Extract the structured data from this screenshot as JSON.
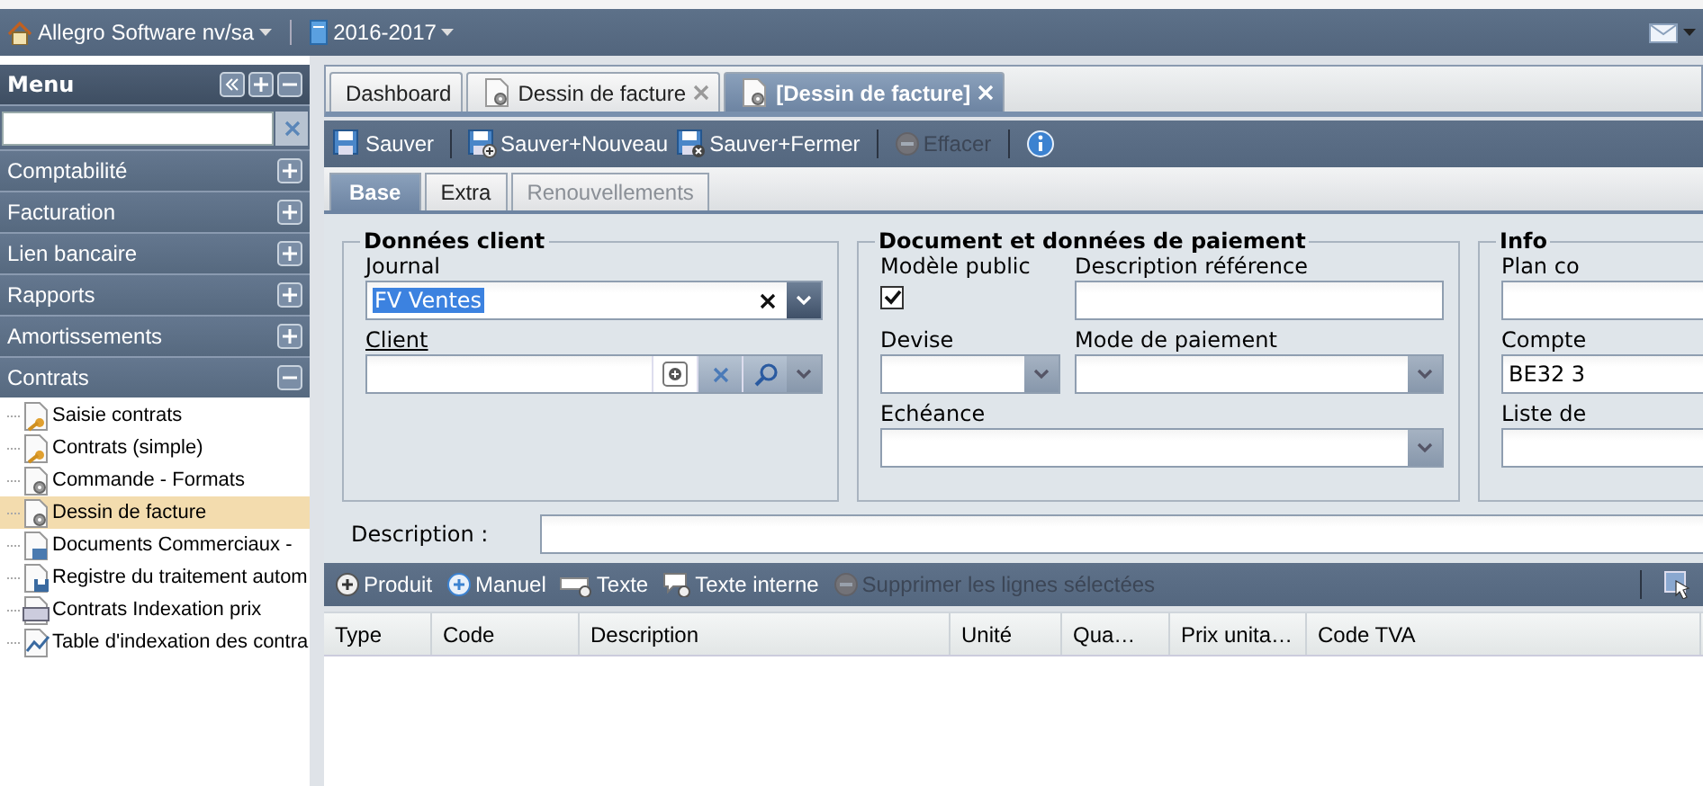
{
  "header": {
    "company": "Allegro Software nv/sa",
    "year": "2016-2017"
  },
  "menu": {
    "title": "Menu",
    "sections": [
      {
        "label": "Comptabilité",
        "expanded": false
      },
      {
        "label": "Facturation",
        "expanded": false
      },
      {
        "label": "Lien bancaire",
        "expanded": false
      },
      {
        "label": "Rapports",
        "expanded": false
      },
      {
        "label": "Amortissements",
        "expanded": false
      },
      {
        "label": "Contrats",
        "expanded": true,
        "items": [
          {
            "label": "Saisie contrats",
            "kind": "key",
            "selected": false
          },
          {
            "label": "Contrats (simple)",
            "kind": "key",
            "selected": false
          },
          {
            "label": "Commande - Formats",
            "kind": "gear",
            "selected": false
          },
          {
            "label": "Dessin de facture",
            "kind": "gear",
            "selected": true
          },
          {
            "label": "Documents Commerciaux -",
            "kind": "report",
            "selected": false
          },
          {
            "label": "Registre du traitement autom",
            "kind": "disk",
            "selected": false
          },
          {
            "label": "Contrats Indexation prix",
            "kind": "printer",
            "selected": false
          },
          {
            "label": "Table d'indexation des contra",
            "kind": "chart",
            "selected": false
          }
        ]
      }
    ]
  },
  "tabs": [
    {
      "label": "Dashboard",
      "kind": "plain",
      "closable": false,
      "selected": false
    },
    {
      "label": "Dessin de facture",
      "kind": "document",
      "closable": true,
      "selected": false
    },
    {
      "label": "[Dessin de facture]",
      "kind": "document",
      "closable": true,
      "selected": true
    }
  ],
  "toolbar": [
    {
      "label": "Sauver",
      "kind": "save",
      "disabled": false
    },
    {
      "kind": "separator"
    },
    {
      "label": "Sauver+Nouveau",
      "kind": "save-new",
      "disabled": false
    },
    {
      "label": "Sauver+Fermer",
      "kind": "save-close",
      "disabled": false
    },
    {
      "kind": "separator"
    },
    {
      "label": "Effacer",
      "kind": "delete",
      "disabled": true
    },
    {
      "kind": "separator"
    },
    {
      "kind": "info",
      "disabled": false
    }
  ],
  "subtabs": [
    {
      "label": "Base",
      "selected": true,
      "disabled": false
    },
    {
      "label": "Extra",
      "selected": false,
      "disabled": false
    },
    {
      "label": "Renouvellements",
      "selected": false,
      "disabled": true
    }
  ],
  "client": {
    "legend": "Données client",
    "journal": {
      "label": "Journal",
      "value": "FV Ventes"
    },
    "client": {
      "label": "Client"
    }
  },
  "payment": {
    "legend": "Document et données de paiement",
    "public_template": {
      "label": "Modèle public",
      "checked": true
    },
    "reference": {
      "label": "Description référence"
    },
    "currency": {
      "label": "Devise"
    },
    "payment_mode": {
      "label": "Mode de paiement"
    },
    "due": {
      "label": "Echéance"
    }
  },
  "info": {
    "legend": "Info",
    "fields": [
      {
        "label": "Plan co"
      },
      {
        "label": "Compte",
        "value": "BE32 3"
      },
      {
        "label": "Liste de"
      }
    ]
  },
  "description": {
    "label": "Description :"
  },
  "lines_toolbar": [
    {
      "label": "Produit",
      "kind": "add",
      "disabled": false
    },
    {
      "label": "Manuel",
      "kind": "add-blue",
      "disabled": false
    },
    {
      "label": "Texte",
      "kind": "text",
      "disabled": false
    },
    {
      "label": "Texte interne",
      "kind": "comment",
      "disabled": false
    },
    {
      "label": "Supprimer les lignes sélectées",
      "kind": "remove",
      "disabled": true
    }
  ],
  "columns": [
    "Type",
    "Code",
    "Description",
    "Unité",
    "Qua…",
    "Prix unita…",
    "Code TVA"
  ]
}
